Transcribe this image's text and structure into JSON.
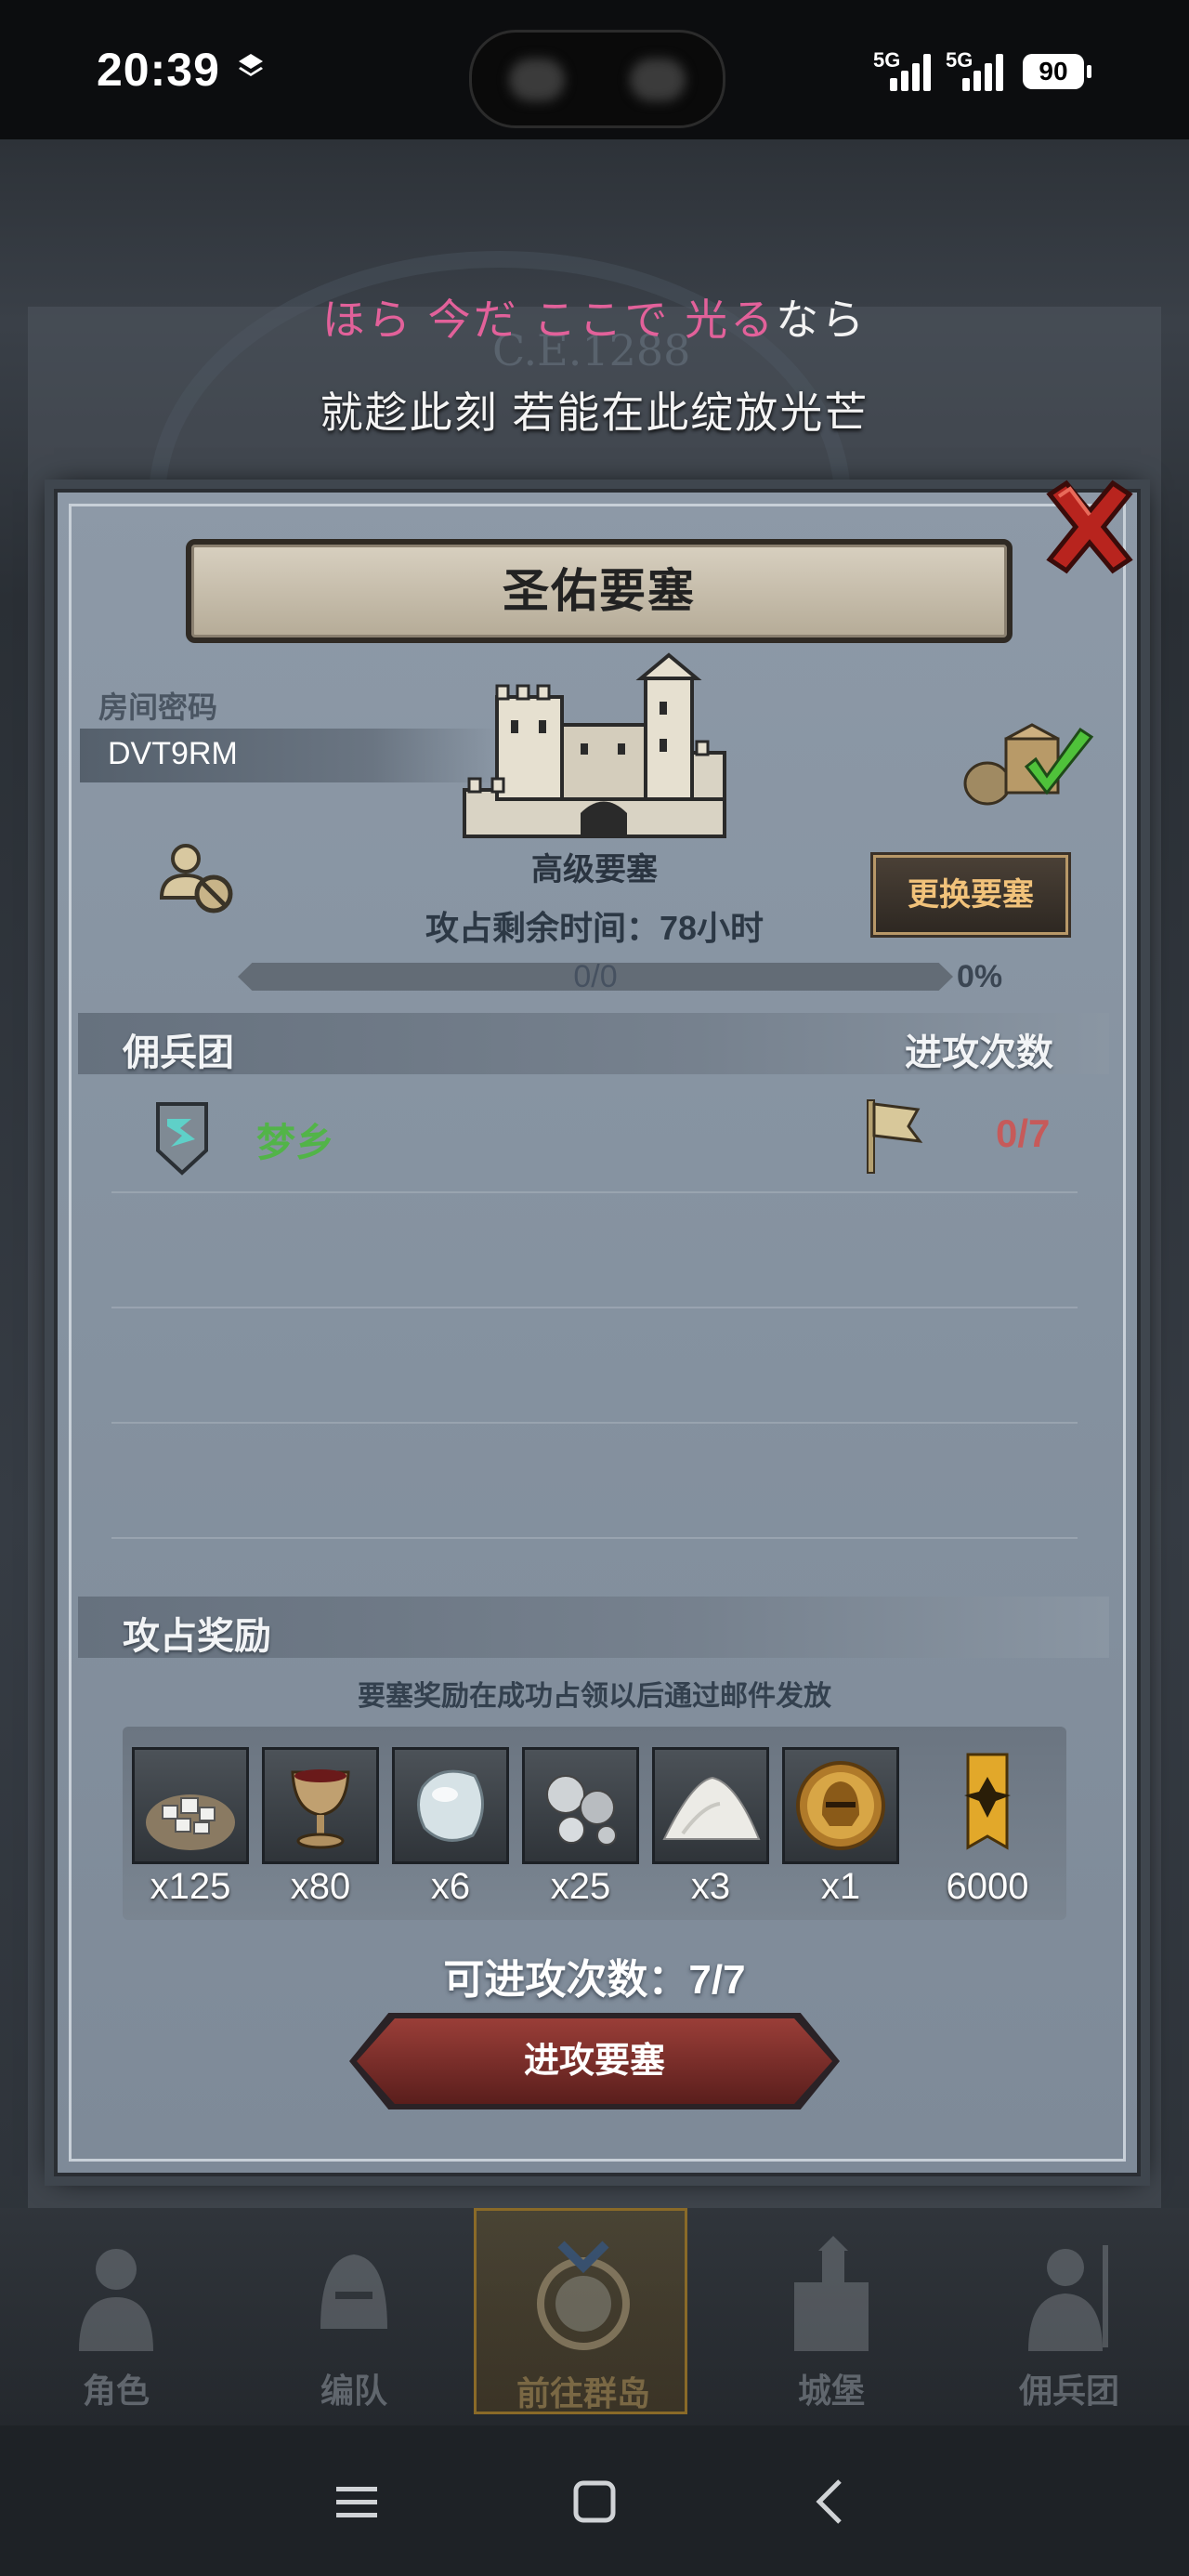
{
  "status_bar": {
    "time": "20:39",
    "layers_icon": "layers-icon",
    "signal1_label": "5G",
    "signal2_label": "5G",
    "battery": "90"
  },
  "lyrics": {
    "line1_parts": [
      {
        "text": "ほら 今だ ここで 光る",
        "color": "#e2619a"
      },
      {
        "text": "なら",
        "color": "#f3f3f3"
      }
    ],
    "line2": "就趁此刻 若能在此绽放光芒"
  },
  "background": {
    "map_stamp": "C.E.1288"
  },
  "dialog": {
    "title": "圣佑要塞",
    "close_icon": "close-x-icon",
    "room_code_label": "房间密码",
    "room_code": "DVT9RM",
    "fortress_level": "高级要塞",
    "change_fortress": "更换要塞",
    "time_left": "攻占剩余时间：78小时",
    "progress_text": "0/0",
    "progress_pct": "0%",
    "progress_value": 0,
    "mercenary_header": "佣兵团",
    "attack_count_header": "进攻次数",
    "guild": {
      "name": "梦乡",
      "attacks": "0/7"
    },
    "rewards_header": "攻占奖励",
    "reward_note": "要塞奖励在成功占领以后通过邮件发放",
    "rewards": [
      {
        "icon": "silver-ore-sack-icon",
        "qty": "x125"
      },
      {
        "icon": "goblet-icon",
        "qty": "x80"
      },
      {
        "icon": "moonstone-icon",
        "qty": "x6"
      },
      {
        "icon": "silver-pearls-icon",
        "qty": "x25"
      },
      {
        "icon": "salt-pile-icon",
        "qty": "x3"
      },
      {
        "icon": "gold-helmet-medal-icon",
        "qty": "x1"
      },
      {
        "icon": "guild-banner-icon",
        "qty": "6000"
      }
    ],
    "available_attacks": "可进攻次数：7/7",
    "attack_button": "进攻要塞"
  },
  "game_nav": [
    {
      "label": "角色",
      "icon": "knight-icon"
    },
    {
      "label": "编队",
      "icon": "helmet-icon"
    },
    {
      "label": "前往群岛",
      "icon": "globe-compass-icon"
    },
    {
      "label": "城堡",
      "icon": "castle-icon"
    },
    {
      "label": "佣兵团",
      "icon": "warrior-icon"
    }
  ],
  "colors": {
    "accent_green": "#52b448",
    "attack_red": "#c65a5a",
    "button_gold": "#f1c27a",
    "lyric_pink": "#e2619a"
  }
}
